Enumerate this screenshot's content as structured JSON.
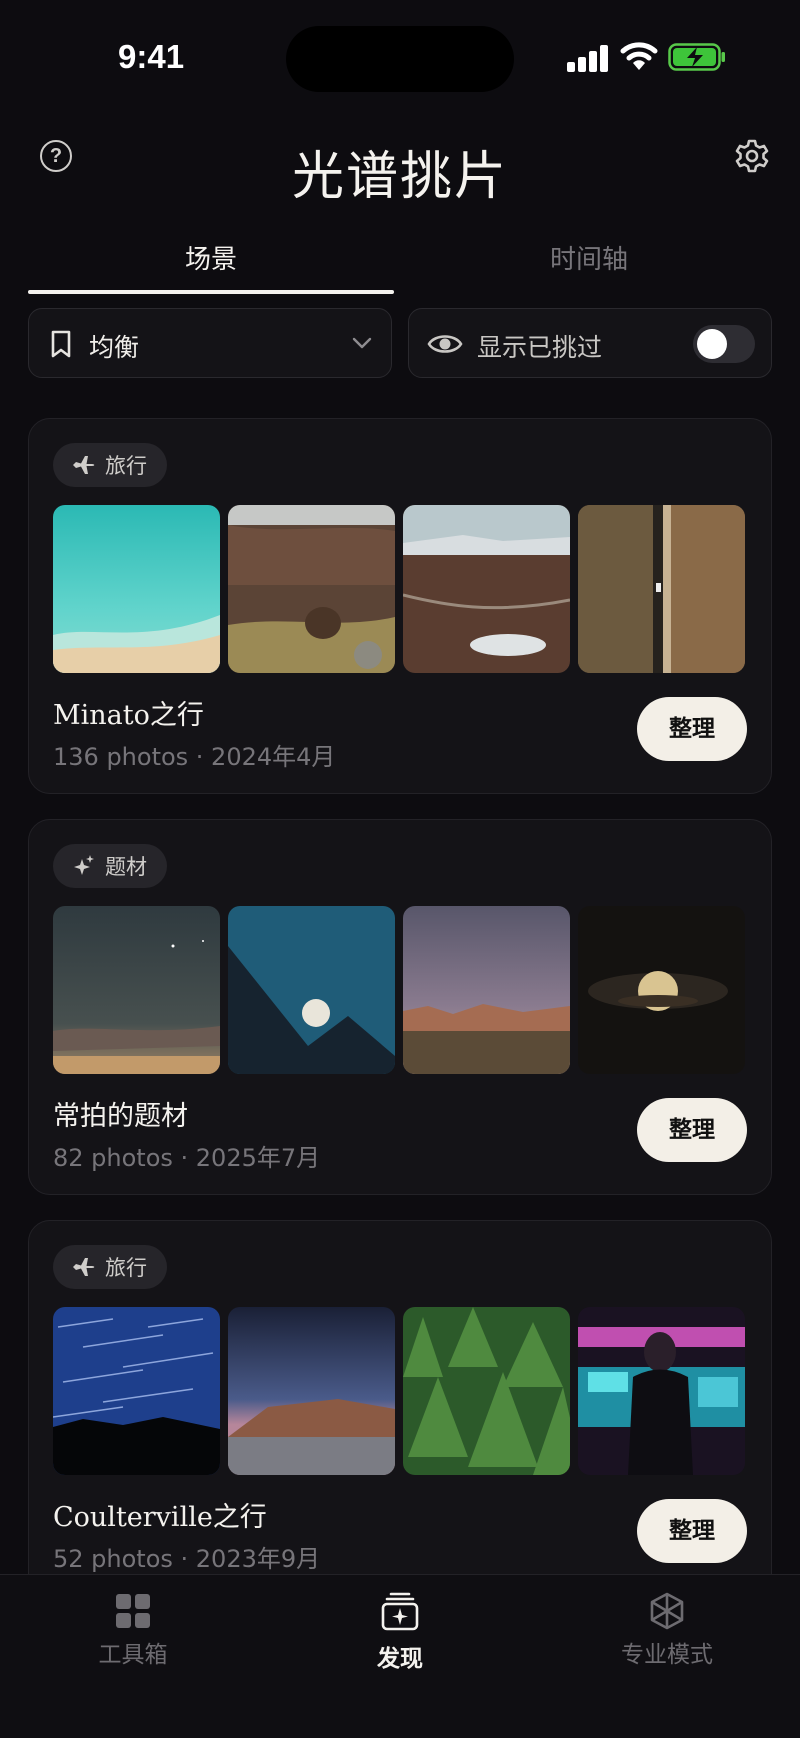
{
  "status_bar": {
    "time": "9:41"
  },
  "header": {
    "title": "光谱挑片",
    "help_glyph": "?"
  },
  "tabs": [
    {
      "label": "场景",
      "active": true
    },
    {
      "label": "时间轴",
      "active": false
    }
  ],
  "filters": {
    "mode_label": "均衡",
    "show_picked_label": "显示已挑过",
    "show_picked_on": false
  },
  "cards": [
    {
      "tag": "旅行",
      "tag_icon": "airplane-icon",
      "title": "Minato之行",
      "meta": "136 photos · 2024年4月",
      "button": "整理",
      "thumbnails": [
        "turquoise-beach",
        "fox-in-grass",
        "highland-valley",
        "aerial-road-field"
      ]
    },
    {
      "tag": "题材",
      "tag_icon": "sparkle-icon",
      "title": "常拍的题材",
      "meta": "82 photos · 2025年7月",
      "button": "整理",
      "thumbnails": [
        "dusk-starry-sky",
        "moonrise-over-cliff",
        "desert-twilight-mountains",
        "full-moon-night-clouds"
      ]
    },
    {
      "tag": "旅行",
      "tag_icon": "airplane-icon",
      "title": "Coulterville之行",
      "meta": "52 photos · 2023年9月",
      "button": "整理",
      "thumbnails": [
        "star-trails",
        "dusk-mesa",
        "pine-forest",
        "neon-portrait"
      ]
    }
  ],
  "tab_bar": [
    {
      "label": "工具箱",
      "icon": "grid-icon",
      "active": false
    },
    {
      "label": "发现",
      "icon": "discover-icon",
      "active": true
    },
    {
      "label": "专业模式",
      "icon": "cube-icon",
      "active": false
    }
  ],
  "colors": {
    "background": "#0d0c10",
    "card": "#141317",
    "button": "#f3efe7",
    "muted": "#77757a"
  }
}
